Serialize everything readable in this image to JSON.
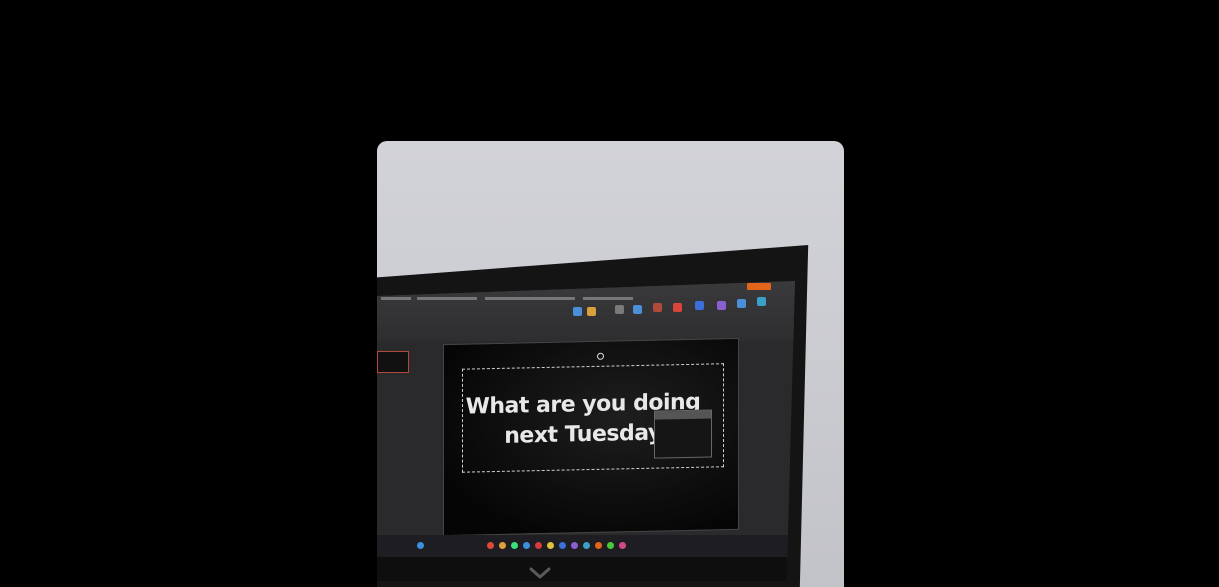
{
  "viewer": {
    "background_color": "#000000"
  },
  "photo": {
    "slide_text_line1": "What are you doing",
    "slide_text_line2": "next Tuesday",
    "accent_color": "#e3641a"
  },
  "controls": {
    "next_icon": "chevron-down-icon"
  }
}
